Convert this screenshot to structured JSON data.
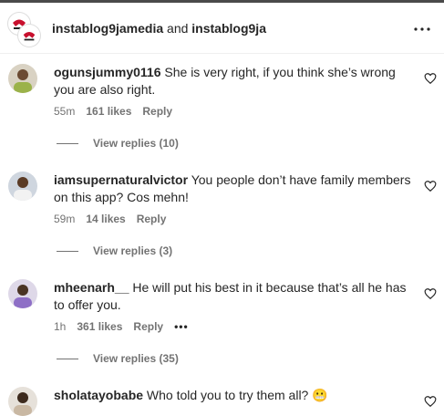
{
  "header": {
    "user1": "instablog9jamedia",
    "conjunction": "and",
    "user2": "instablog9ja"
  },
  "comments": [
    {
      "username": "ogunsjummy0116",
      "text": "She is very right, if you think she’s wrong you are also right.",
      "time": "55m",
      "likes": "161 likes",
      "reply": "Reply",
      "view_replies": "View replies (10)"
    },
    {
      "username": "iamsupernaturalvictor",
      "text": "You people don’t have family members on this app? Cos mehn!",
      "time": "59m",
      "likes": "14 likes",
      "reply": "Reply",
      "view_replies": "View replies (3)"
    },
    {
      "username": "mheenarh__",
      "text": "He will put his best in it because that’s all he has to offer you.",
      "time": "1h",
      "likes": "361 likes",
      "reply": "Reply",
      "view_replies": "View replies (35)"
    },
    {
      "username": "sholatayobabe",
      "text": "Who told you to try them all?",
      "emoji": "😬"
    }
  ],
  "colors": {
    "text": "#262626",
    "secondary": "#737373",
    "divider": "#efefef",
    "brand_red": "#c8102e"
  }
}
